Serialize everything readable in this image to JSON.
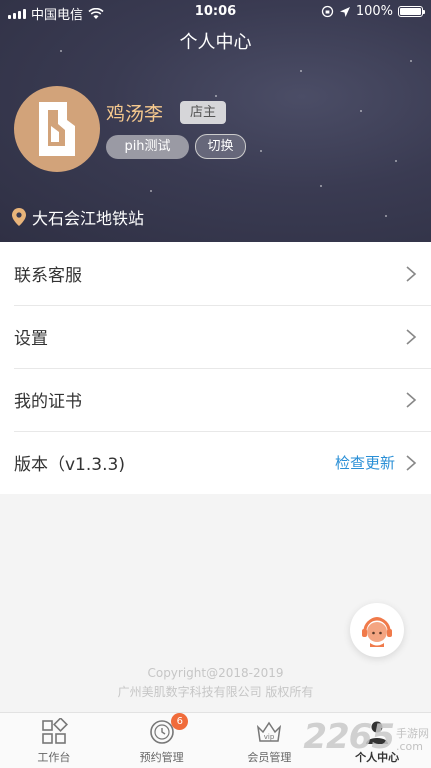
{
  "status_bar": {
    "carrier": "中国电信",
    "time": "10:06",
    "battery": "100%",
    "battery_level": 1.0
  },
  "header": {
    "title": "个人中心"
  },
  "profile": {
    "name": "鸡汤李",
    "role": "店主",
    "shop": "pih测试",
    "switch_label": "切换",
    "location": "大石会江地铁站"
  },
  "menu": {
    "items": [
      {
        "label": "联系客服",
        "extra": ""
      },
      {
        "label": "设置",
        "extra": ""
      },
      {
        "label": "我的证书",
        "extra": ""
      },
      {
        "label": "版本（v1.3.3)",
        "extra": "检查更新"
      }
    ]
  },
  "footer": {
    "copyright_line1": "Copyright@2018-2019",
    "copyright_line2": "广州美肌数字科技有限公司 版权所有"
  },
  "tabbar": {
    "tabs": [
      {
        "label": "工作台",
        "icon": "grid-icon"
      },
      {
        "label": "预约管理",
        "icon": "clock-icon",
        "badge": "6"
      },
      {
        "label": "会员管理",
        "icon": "vip-crown-icon"
      },
      {
        "label": "个人中心",
        "icon": "person-icon",
        "active": true
      }
    ]
  },
  "watermark": {
    "number": "2265",
    "line1": "手游网",
    ".com": ".com"
  },
  "colors": {
    "header_bg": "#3a3b52",
    "name_gold": "#f6c98e",
    "link_blue": "#2a8fd6",
    "badge_orange": "#f06b3a",
    "avatar_bg": "#d2a37a"
  }
}
